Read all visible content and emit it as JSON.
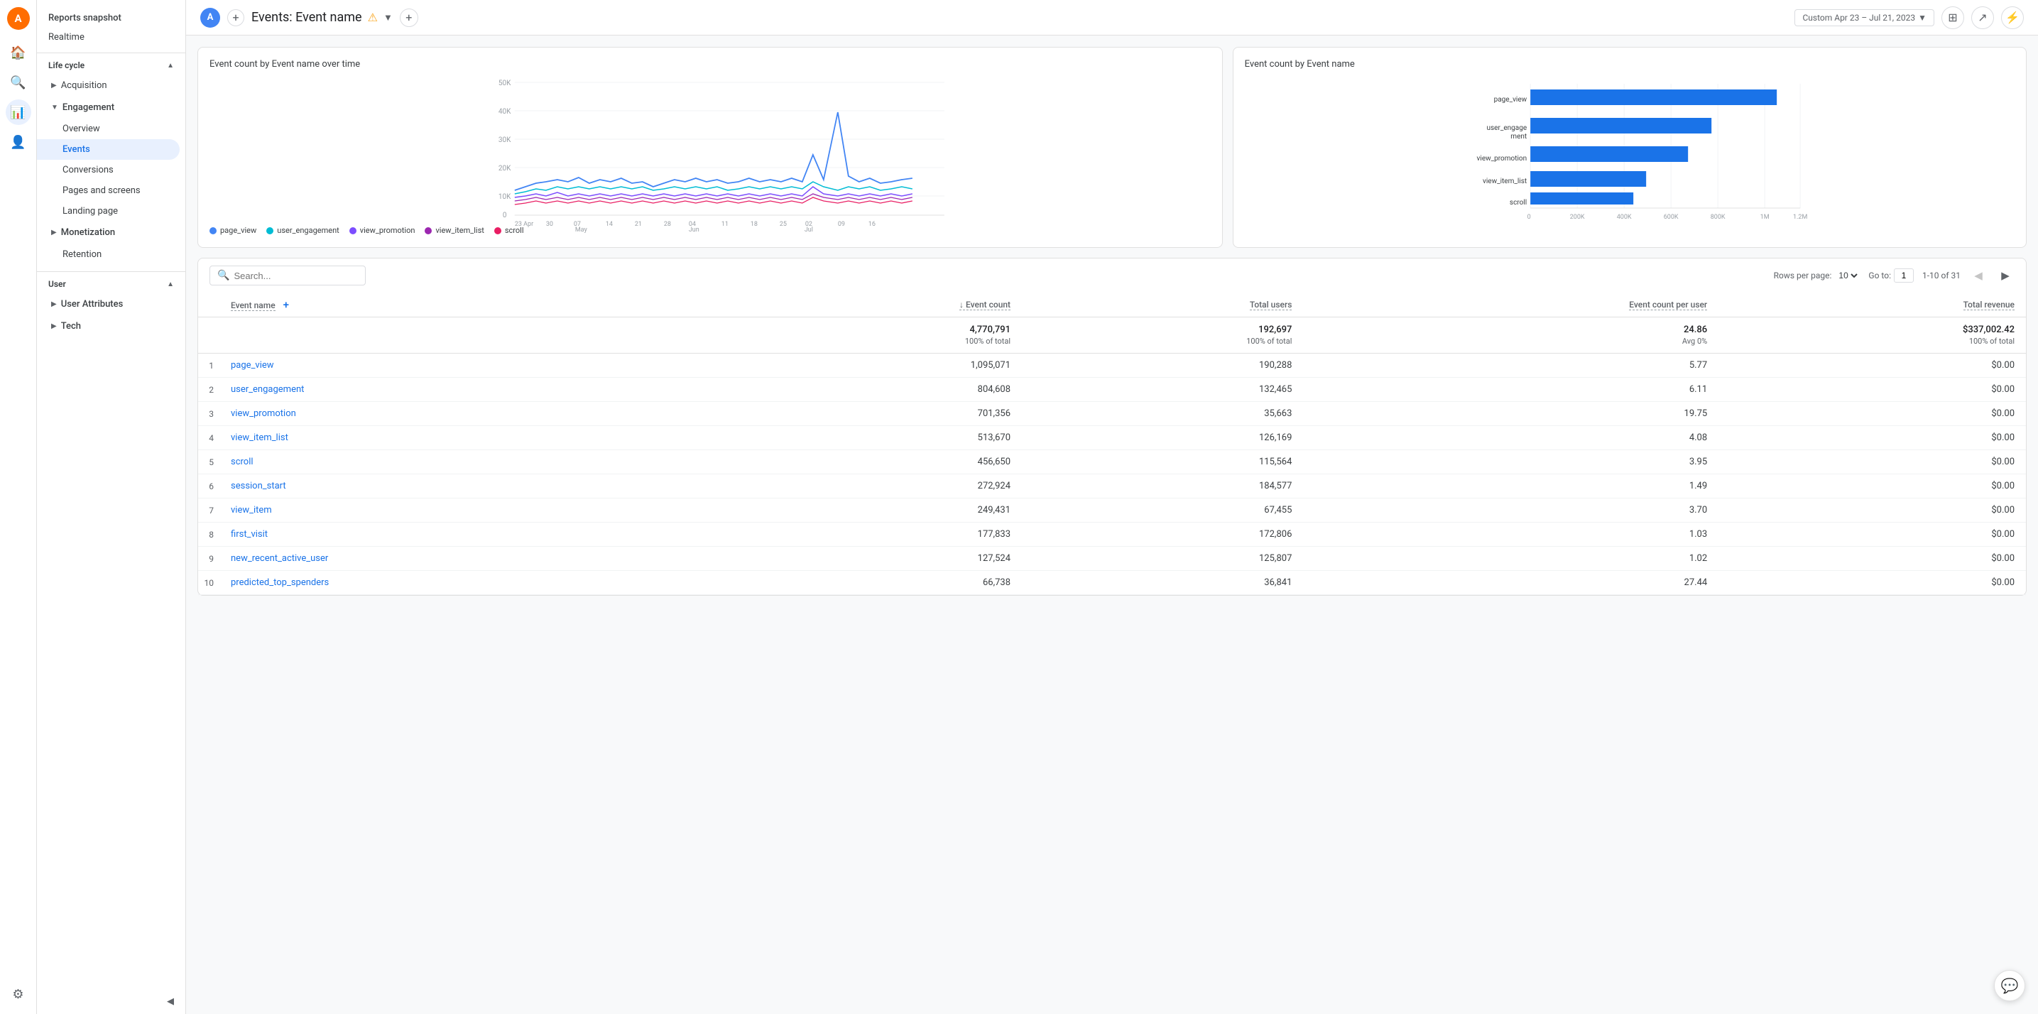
{
  "app": {
    "logo_letter": "A",
    "title": "Reports snapshot",
    "realtime": "Realtime"
  },
  "topbar": {
    "avatar_letter": "A",
    "page_title": "Events: Event name",
    "warning_icon": "⚠",
    "date_range": "Custom  Apr 23 – Jul 21, 2023",
    "add_plus": "+",
    "plus": "+"
  },
  "nav": {
    "lifecycle_section": "Life cycle",
    "acquisition": "Acquisition",
    "engagement": "Engagement",
    "engagement_items": [
      "Overview",
      "Events",
      "Conversions",
      "Pages and screens",
      "Landing page"
    ],
    "monetization": "Monetization",
    "retention": "Retention",
    "user_section": "User",
    "user_attributes": "User Attributes",
    "tech": "Tech"
  },
  "line_chart": {
    "title": "Event count by Event name over time",
    "x_labels": [
      "23 Apr",
      "30",
      "07 May",
      "14",
      "21",
      "28",
      "04 Jun",
      "11",
      "18",
      "25",
      "02 Jul",
      "09",
      "16"
    ],
    "y_labels": [
      "50K",
      "40K",
      "30K",
      "20K",
      "10K",
      "0"
    ],
    "series": [
      "page_view",
      "user_engagement",
      "view_promotion",
      "view_item_list",
      "scroll"
    ],
    "colors": [
      "#4285f4",
      "#00bcd4",
      "#7c4dff",
      "#9c27b0",
      "#e91e63"
    ]
  },
  "bar_chart": {
    "title": "Event count by Event name",
    "x_labels": [
      "0",
      "200K",
      "400K",
      "600K",
      "800K",
      "1M",
      "1.2M"
    ],
    "bars": [
      {
        "label": "page_view",
        "value": 1095071,
        "max": 1200000
      },
      {
        "label": "user_engage\nment",
        "value": 804608,
        "max": 1200000
      },
      {
        "label": "view_promotion",
        "value": 701356,
        "max": 1200000
      },
      {
        "label": "view_item_list",
        "value": 513670,
        "max": 1200000
      },
      {
        "label": "scroll",
        "value": 456650,
        "max": 1200000
      }
    ],
    "bar_color": "#1a73e8"
  },
  "table": {
    "search_placeholder": "Search...",
    "rows_per_page_label": "Rows per page:",
    "rows_per_page": "10",
    "go_to_label": "Go to:",
    "go_to_value": "1",
    "pagination": "1-10 of 31",
    "col_event_name": "Event name",
    "col_event_count": "↓ Event count",
    "col_total_users": "Total users",
    "col_event_count_per_user": "Event count per user",
    "col_total_revenue": "Total revenue",
    "summary": {
      "event_count": "4,770,791",
      "event_count_pct": "100% of total",
      "total_users": "192,697",
      "total_users_pct": "100% of total",
      "event_count_per_user": "24.86",
      "event_count_per_user_avg": "Avg 0%",
      "total_revenue": "$337,002.42",
      "total_revenue_pct": "100% of total"
    },
    "rows": [
      {
        "num": 1,
        "name": "page_view",
        "event_count": "1,095,071",
        "total_users": "190,288",
        "per_user": "5.77",
        "revenue": "$0.00"
      },
      {
        "num": 2,
        "name": "user_engagement",
        "event_count": "804,608",
        "total_users": "132,465",
        "per_user": "6.11",
        "revenue": "$0.00"
      },
      {
        "num": 3,
        "name": "view_promotion",
        "event_count": "701,356",
        "total_users": "35,663",
        "per_user": "19.75",
        "revenue": "$0.00"
      },
      {
        "num": 4,
        "name": "view_item_list",
        "event_count": "513,670",
        "total_users": "126,169",
        "per_user": "4.08",
        "revenue": "$0.00"
      },
      {
        "num": 5,
        "name": "scroll",
        "event_count": "456,650",
        "total_users": "115,564",
        "per_user": "3.95",
        "revenue": "$0.00"
      },
      {
        "num": 6,
        "name": "session_start",
        "event_count": "272,924",
        "total_users": "184,577",
        "per_user": "1.49",
        "revenue": "$0.00"
      },
      {
        "num": 7,
        "name": "view_item",
        "event_count": "249,431",
        "total_users": "67,455",
        "per_user": "3.70",
        "revenue": "$0.00"
      },
      {
        "num": 8,
        "name": "first_visit",
        "event_count": "177,833",
        "total_users": "172,806",
        "per_user": "1.03",
        "revenue": "$0.00"
      },
      {
        "num": 9,
        "name": "new_recent_active_user",
        "event_count": "127,524",
        "total_users": "125,807",
        "per_user": "1.02",
        "revenue": "$0.00"
      },
      {
        "num": 10,
        "name": "predicted_top_spenders",
        "event_count": "66,738",
        "total_users": "36,841",
        "per_user": "27.44",
        "revenue": "$0.00"
      }
    ]
  },
  "icons": {
    "home": "⌂",
    "search": "○",
    "analytics": "📊",
    "settings": "⚙",
    "chat": "💬",
    "chevron_down": "▼",
    "chevron_right": "▶",
    "chevron_left": "◀",
    "collapse": "◀",
    "compare": "⊞",
    "share": "↗",
    "trend": "↗"
  },
  "colors": {
    "page_view": "#4285f4",
    "user_engagement": "#00bcd4",
    "view_promotion": "#7c4dff",
    "view_item_list": "#9c27b0",
    "scroll": "#e91e63",
    "bar": "#1a73e8",
    "active_nav": "#e8f0fe",
    "active_text": "#1a73e8"
  }
}
